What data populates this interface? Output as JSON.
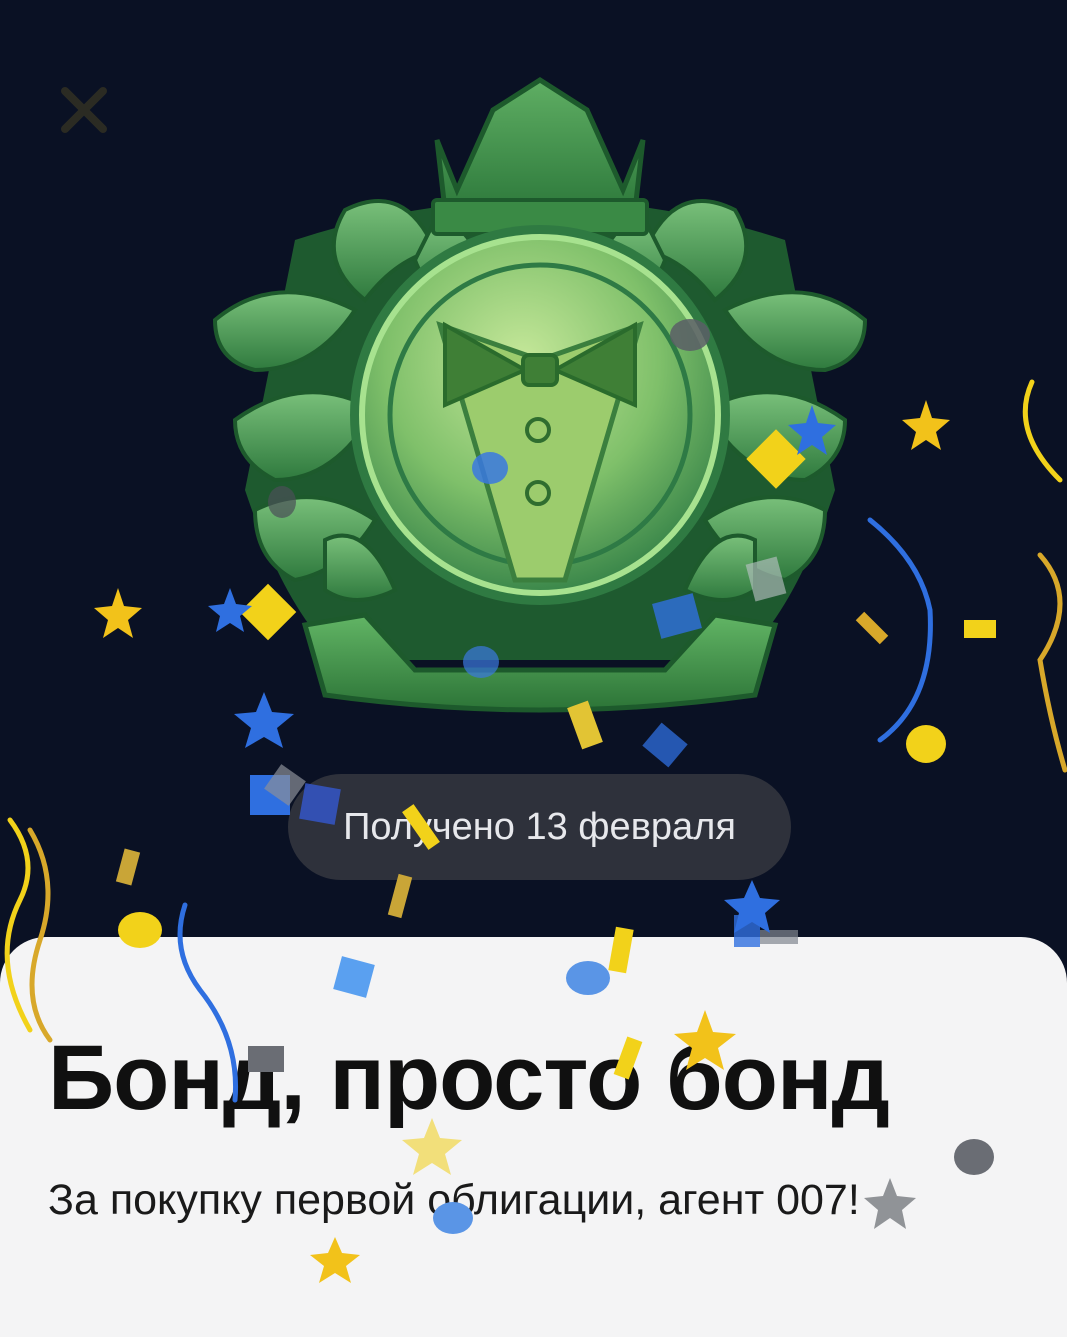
{
  "screen": {
    "date_label": "Получено 13 февраля",
    "title": "Бонд, просто бонд",
    "description": "За покупку первой облигации, агент 007!"
  },
  "icons": {
    "close": "close-icon",
    "badge": "tuxedo-crest-badge"
  },
  "colors": {
    "background": "#0a1124",
    "sheet": "#f4f4f5",
    "pill": "#2e313b",
    "badge_green": "#3f8a45",
    "confetti_yellow": "#f2d21a",
    "confetti_blue": "#2f6fe0"
  }
}
